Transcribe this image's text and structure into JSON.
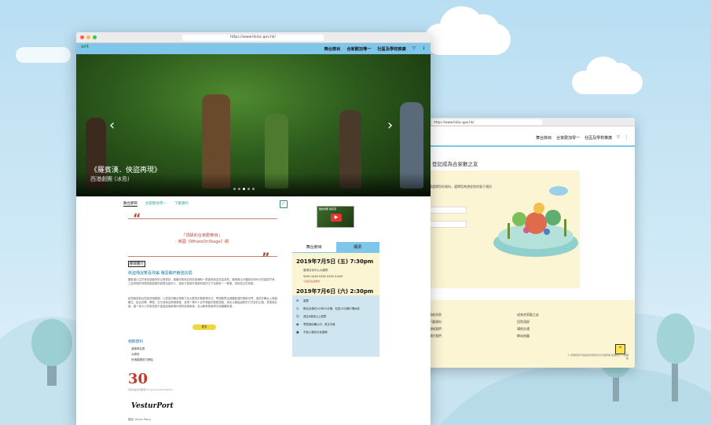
{
  "background": {
    "sky_color": "#b9def2",
    "hill_color": "#d9eef6"
  },
  "main_window": {
    "url": "https://www.hkiac.gov.hk/",
    "logo_text": "ort",
    "nav": [
      "舞台節目",
      "合家歡加零一",
      "社區及學校推廣"
    ],
    "nav_icons": [
      "filter-icon",
      "more-vertical-icon"
    ],
    "hero": {
      "title": "《羅賓漢．俠盜再現》",
      "subtitle": "西港劇團 (冰島)",
      "prev_icon": "chevron-left-icon",
      "next_icon": "chevron-right-icon",
      "slides": 5,
      "active_slide": 3
    },
    "tabs": [
      "舞台節目",
      "合家歡加零一",
      "下載資料"
    ],
    "quote": {
      "line1": "「頂級的合家歡節目」",
      "line2": "- 英國《WhatsOnStage》網"
    },
    "section_tag": "節目簡介",
    "section_title": "俠盜傳說驚喜改編 殲惡鋤奸鏟強扶弱",
    "para1": "羅賓漢以生於舍伍德森林的山野男孩，隨著成長與自然的靈魂和一群森林朋友劫富濟貧，隨時救出大羅賓在時代中的善惡鬥爭，之並奔揚於林間來跑惡霸的城堡及盔甲人，運用才智與本領將邪惡的王子及權貴一一擊退，成就真正的英雄。",
    "para2": "創意雜耍與台勁旅西港劇團，以豐富的舞台想像力及大膽的形體劇場手法，帶領觀眾走進羅賓漢的傳奇世界。演員在舞台上飛越騰空，結合劍擊、攀爬、空中藝術及現場音樂，呈現一場令人目不暇給的冒險旅程。演出以輕鬆幽默的方式探討正義、勇氣與友誼，讓一家大小於歡笑聲中重溫這個家傳戶曉的英雄故事，並以嶄新角度再次認識羅賓漢。",
    "more_label": "更多",
    "related_title": "相關資料",
    "related_items": [
      "演藝節目表",
      "大師班",
      "西港劇團官方網站"
    ],
    "logo_30_text": "30",
    "logo_30_sub": "香港兒童合家歡節 Hong Kong Arts Festival",
    "logo_vest_text": "VesturPort",
    "photo_credit": "攝影: Kevin Parry",
    "video": {
      "title": "雜技劇團 羅賓漢",
      "play_icon": "play-icon"
    },
    "info_tabs": [
      "舞台節目",
      "購票"
    ],
    "show1": {
      "date": "2019年7月5日 (五) 7:30pm",
      "venue": "香港文化中心大劇院",
      "prices": "$580 $480 $380 $280 $180*",
      "note": "*兒童及長者優惠"
    },
    "show2": {
      "date": "2019年7月6日 (六) 2:30pm"
    },
    "venue_box": {
      "heading": "重要",
      "items": [
        "節目全長約2小時15分鐘，包括15分鐘中場休息",
        "適合6歲或以上觀眾",
        "粵語演出輔以中、英文字幕",
        "不設入場及中途進場"
      ]
    }
  },
  "second_window": {
    "url": "https://www.hkiac.gov.hk/",
    "nav": [
      "舞台節目",
      "合家歡加零一",
      "社區及學校推廣"
    ],
    "reg_title": "登記成為合家歡之友",
    "panel_text": "請選擇您的資料，選擇您希望收到的電子通訊",
    "footer_cols": [
      [
        "最新消息",
        "下載資料",
        "聯絡我們",
        "關於我們"
      ],
      [
        "成為合家歡之友",
        "回到頂部",
        "場地交通",
        "網站地圖"
      ]
    ],
    "copyright": "© 香港特別行政區政府康樂及文化事務署 版權所有 不得轉載",
    "up_icon": "chevron-up-icon"
  }
}
